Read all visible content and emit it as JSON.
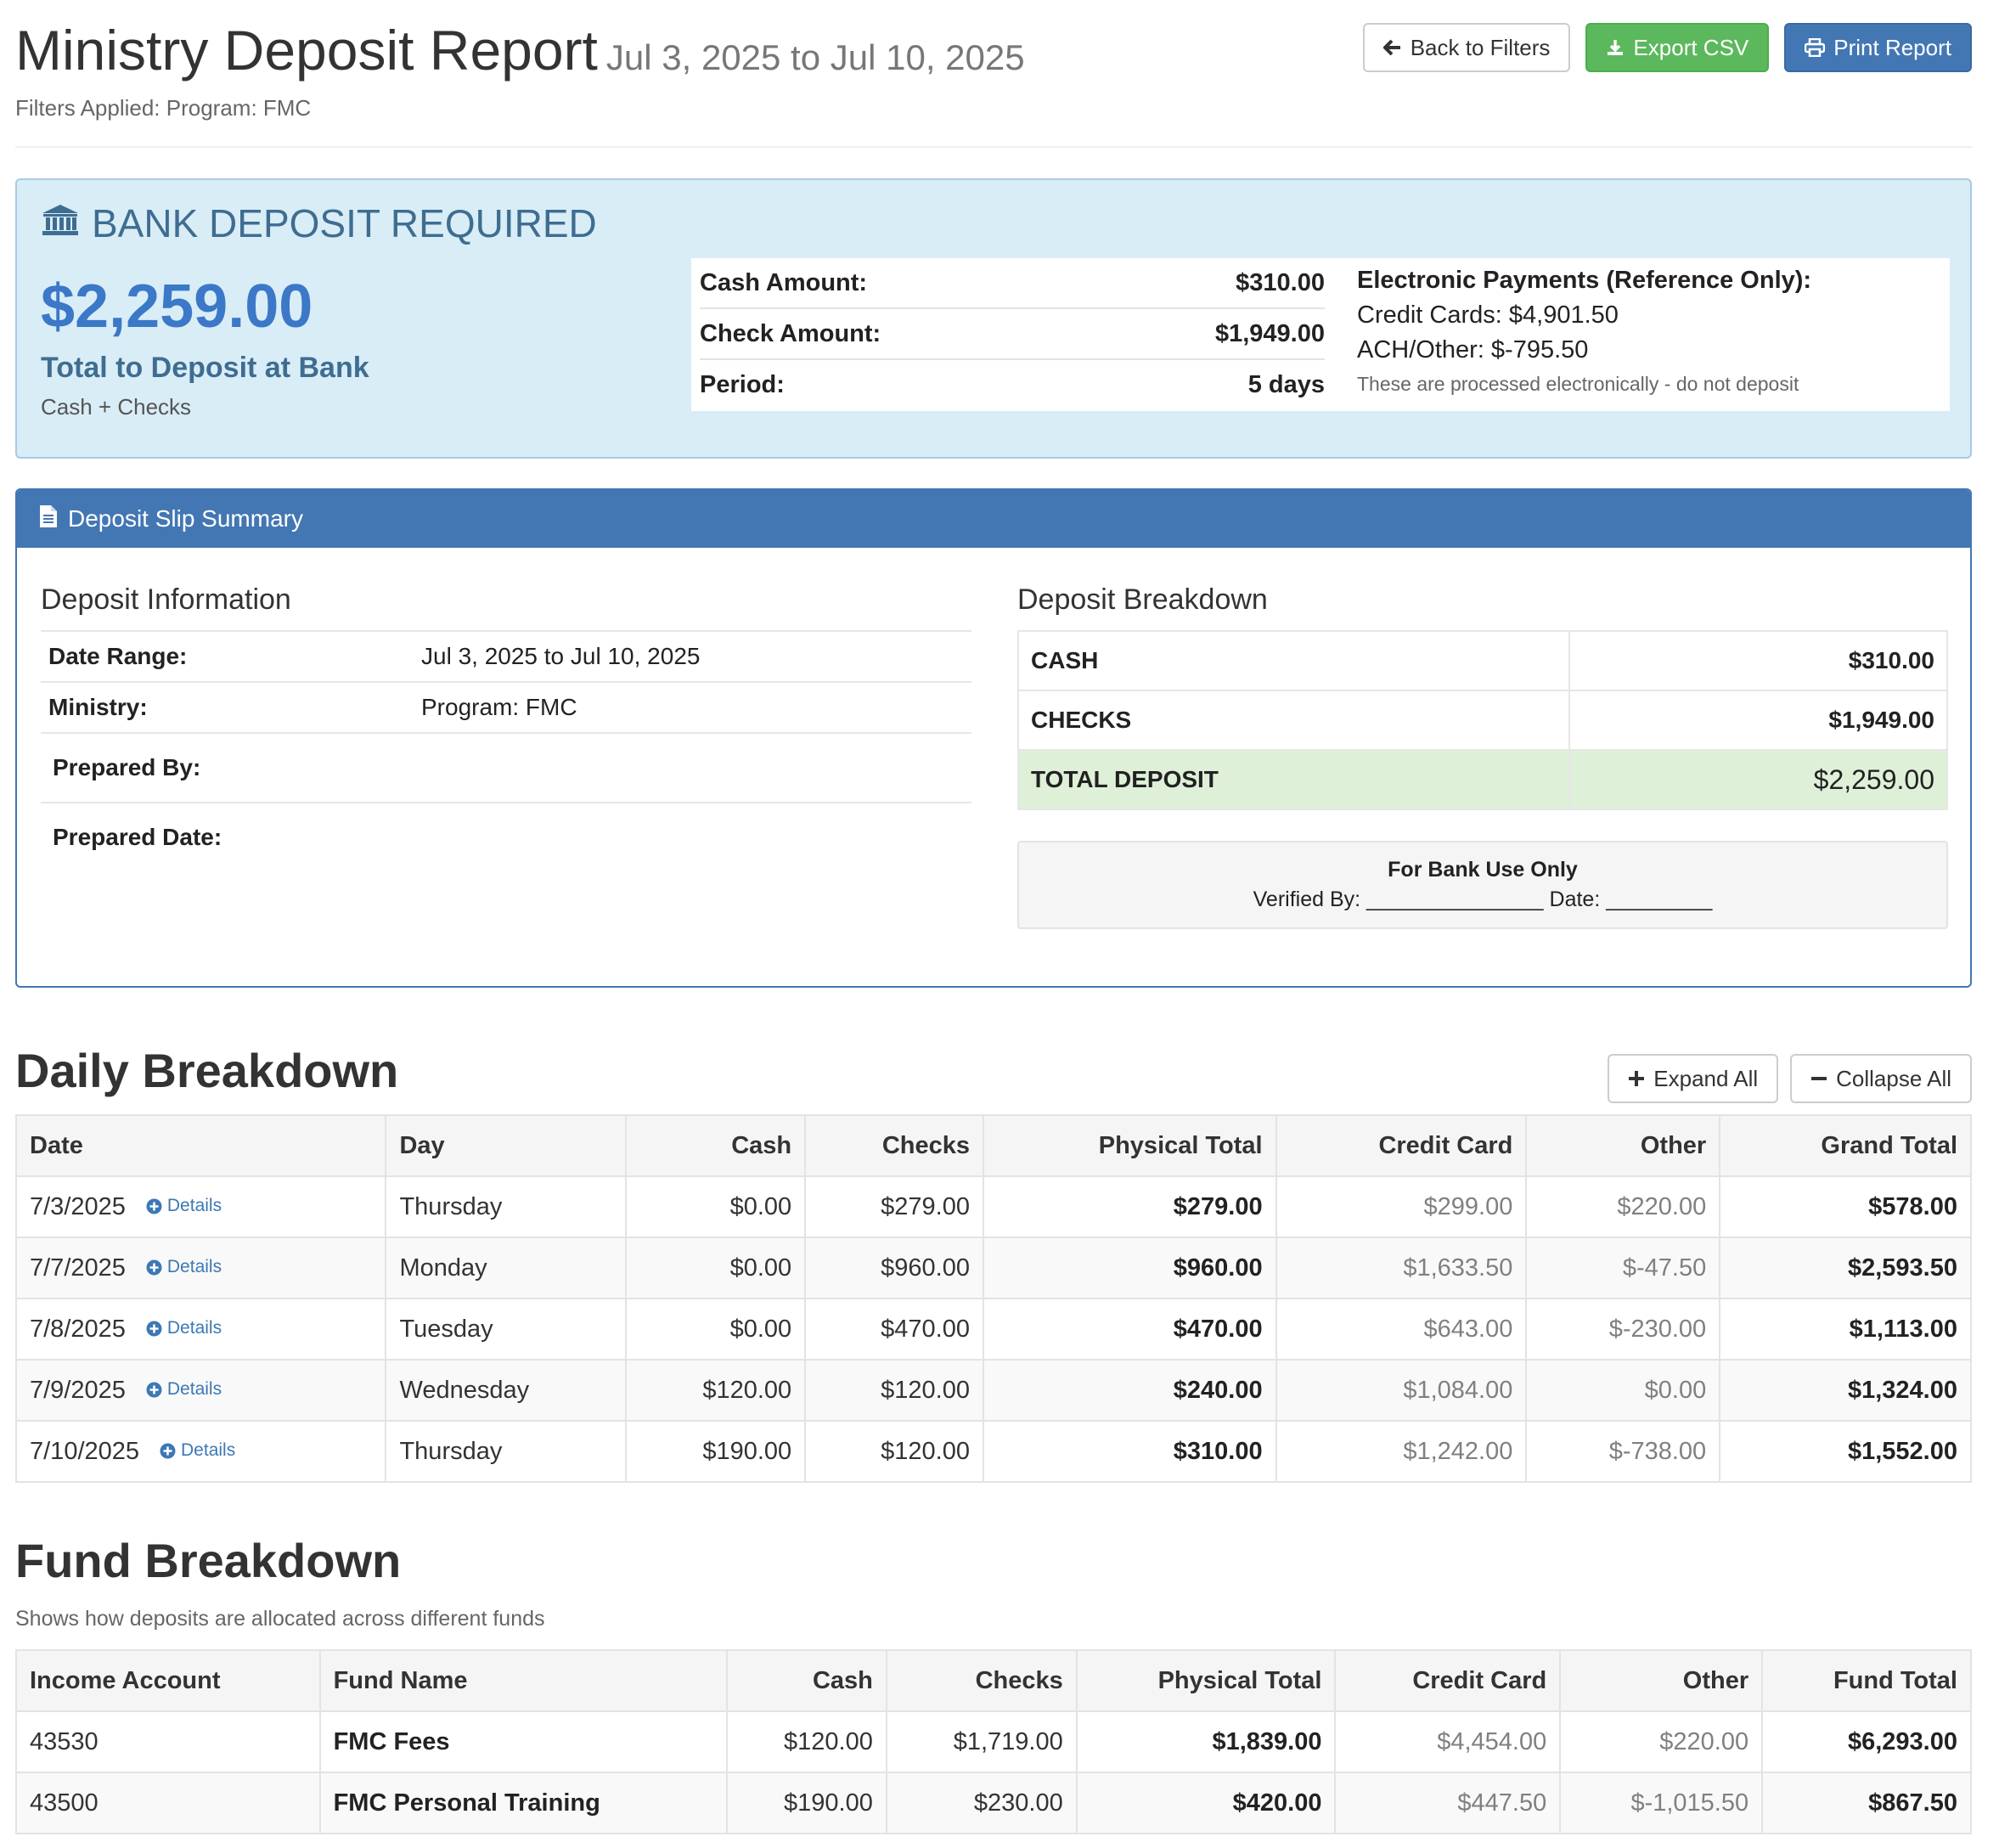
{
  "header": {
    "title": "Ministry Deposit Report",
    "date_range": "Jul 3, 2025 to Jul 10, 2025",
    "filters": "Filters Applied: Program: FMC",
    "buttons": {
      "back": "Back to Filters",
      "export": "Export CSV",
      "print": "Print Report"
    }
  },
  "bank_deposit": {
    "title": "BANK DEPOSIT REQUIRED",
    "amount": "$2,259.00",
    "label": "Total to Deposit at Bank",
    "sub": "Cash + Checks",
    "summary": [
      {
        "label": "Cash Amount:",
        "value": "$310.00"
      },
      {
        "label": "Check Amount:",
        "value": "$1,949.00"
      },
      {
        "label": "Period:",
        "value": "5 days"
      }
    ],
    "electronic": {
      "heading": "Electronic Payments (Reference Only):",
      "credit": "Credit Cards: $4,901.50",
      "ach": "ACH/Other: $-795.50",
      "note": "These are processed electronically - do not deposit"
    }
  },
  "deposit_slip": {
    "title": "Deposit Slip Summary",
    "info_heading": "Deposit Information",
    "info": {
      "date_range_label": "Date Range:",
      "date_range_value": "Jul 3, 2025 to Jul 10, 2025",
      "ministry_label": "Ministry:",
      "ministry_value": "Program: FMC",
      "prepared_by_label": "Prepared By:",
      "prepared_date_label": "Prepared Date:"
    },
    "breakdown_heading": "Deposit Breakdown",
    "breakdown": {
      "cash_label": "CASH",
      "cash_value": "$310.00",
      "checks_label": "CHECKS",
      "checks_value": "$1,949.00",
      "total_label": "TOTAL DEPOSIT",
      "total_value": "$2,259.00"
    },
    "bank_use": {
      "title": "For Bank Use Only",
      "line": "Verified By: _______________ Date: _________"
    }
  },
  "daily": {
    "title": "Daily Breakdown",
    "expand": "Expand All",
    "collapse": "Collapse All",
    "details_label": "Details",
    "headers": [
      "Date",
      "Day",
      "Cash",
      "Checks",
      "Physical Total",
      "Credit Card",
      "Other",
      "Grand Total"
    ],
    "rows": [
      {
        "date": "7/3/2025",
        "day": "Thursday",
        "cash": "$0.00",
        "checks": "$279.00",
        "physical": "$279.00",
        "credit": "$299.00",
        "other": "$220.00",
        "grand": "$578.00"
      },
      {
        "date": "7/7/2025",
        "day": "Monday",
        "cash": "$0.00",
        "checks": "$960.00",
        "physical": "$960.00",
        "credit": "$1,633.50",
        "other": "$-47.50",
        "grand": "$2,593.50"
      },
      {
        "date": "7/8/2025",
        "day": "Tuesday",
        "cash": "$0.00",
        "checks": "$470.00",
        "physical": "$470.00",
        "credit": "$643.00",
        "other": "$-230.00",
        "grand": "$1,113.00"
      },
      {
        "date": "7/9/2025",
        "day": "Wednesday",
        "cash": "$120.00",
        "checks": "$120.00",
        "physical": "$240.00",
        "credit": "$1,084.00",
        "other": "$0.00",
        "grand": "$1,324.00"
      },
      {
        "date": "7/10/2025",
        "day": "Thursday",
        "cash": "$190.00",
        "checks": "$120.00",
        "physical": "$310.00",
        "credit": "$1,242.00",
        "other": "$-738.00",
        "grand": "$1,552.00"
      }
    ]
  },
  "fund": {
    "title": "Fund Breakdown",
    "subtitle": "Shows how deposits are allocated across different funds",
    "headers": [
      "Income Account",
      "Fund Name",
      "Cash",
      "Checks",
      "Physical Total",
      "Credit Card",
      "Other",
      "Fund Total"
    ],
    "rows": [
      {
        "account": "43530",
        "name": "FMC Fees",
        "cash": "$120.00",
        "checks": "$1,719.00",
        "physical": "$1,839.00",
        "credit": "$4,454.00",
        "other": "$220.00",
        "total": "$6,293.00"
      },
      {
        "account": "43500",
        "name": "FMC Personal Training",
        "cash": "$190.00",
        "checks": "$230.00",
        "physical": "$420.00",
        "credit": "$447.50",
        "other": "$-1,015.50",
        "total": "$867.50"
      }
    ]
  },
  "icons": {
    "back": "arrow-left-icon",
    "export": "download-icon",
    "print": "print-icon",
    "bank": "bank-icon",
    "slip": "file-text-icon",
    "expand": "plus-icon",
    "collapse": "minus-icon",
    "details": "plus-circle-icon"
  },
  "colors": {
    "primary": "#4377b3",
    "success": "#5cb85c",
    "info_bg": "#d9edf7",
    "total_bg": "#dff0d8",
    "amount": "#3b78c7"
  }
}
